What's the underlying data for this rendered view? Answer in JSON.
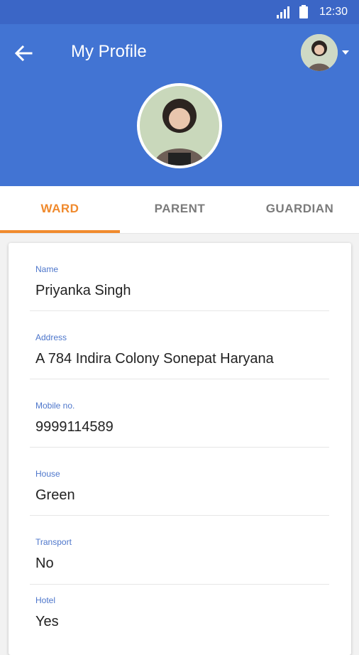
{
  "status_bar": {
    "time": "12:30"
  },
  "app_bar": {
    "title": "My Profile"
  },
  "tabs": [
    {
      "label": "WARD",
      "active": true
    },
    {
      "label": "PARENT",
      "active": false
    },
    {
      "label": "GUARDIAN",
      "active": false
    }
  ],
  "profile": {
    "fields": [
      {
        "label": "Name",
        "value": "Priyanka Singh"
      },
      {
        "label": "Address",
        "value": "A 784 Indira Colony Sonepat Haryana"
      },
      {
        "label": "Mobile no.",
        "value": "9999114589"
      },
      {
        "label": "House",
        "value": "Green"
      },
      {
        "label": "Transport",
        "value": "No"
      },
      {
        "label": "Hotel",
        "value": "Yes"
      }
    ]
  },
  "colors": {
    "app_bar": "#4274d3",
    "status_bar": "#3b66c6",
    "accent": "#f08a2d",
    "field_label": "#4d76cb"
  },
  "icons": {
    "back": "arrow-left-icon",
    "dropdown": "caret-down-icon",
    "signal": "signal-icon",
    "battery": "battery-icon"
  }
}
